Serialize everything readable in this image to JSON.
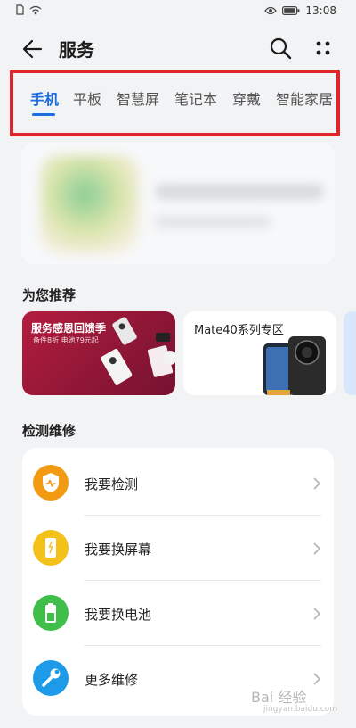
{
  "status_bar": {
    "time": "13:08"
  },
  "header": {
    "title": "服务"
  },
  "tabs": [
    "手机",
    "平板",
    "智慧屏",
    "笔记本",
    "穿戴",
    "智能家居"
  ],
  "active_tab_index": 0,
  "sections": {
    "recommend_title": "为您推荐",
    "repair_title": "检测维修"
  },
  "recommend_cards": [
    {
      "title": "服务感恩回馈季",
      "subtitle": "备件8折 电池79元起"
    },
    {
      "title": "Mate40系列专区"
    }
  ],
  "repair_items": [
    {
      "label": "我要检测",
      "icon": "detect-icon",
      "color": "#f29a12"
    },
    {
      "label": "我要换屏幕",
      "icon": "screen-icon",
      "color": "#f2c21b"
    },
    {
      "label": "我要换电池",
      "icon": "battery-icon",
      "color": "#3fbf4a"
    },
    {
      "label": "更多维修",
      "icon": "wrench-icon",
      "color": "#1e9be8"
    }
  ],
  "colors": {
    "accent": "#1d6fe0",
    "highlight": "#e0262c",
    "background": "#f2f3f5"
  },
  "watermark": {
    "text": "Bai 经验",
    "sub": "jingyan.baidu.com"
  }
}
